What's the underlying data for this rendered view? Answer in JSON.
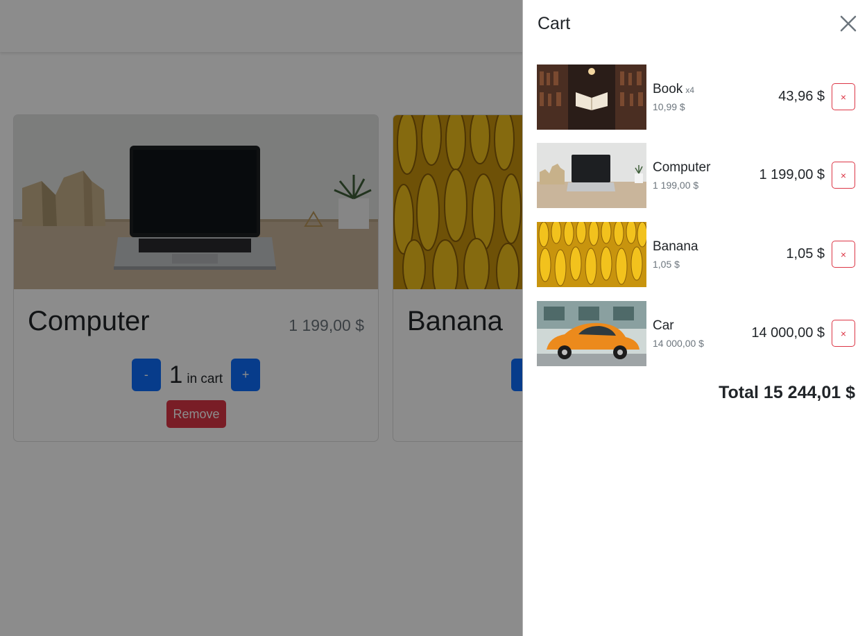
{
  "products": [
    {
      "title": "Computer",
      "price": "1 199,00 $",
      "qty": "1",
      "qty_label": "in cart",
      "minus": "-",
      "plus": "+",
      "remove": "Remove"
    },
    {
      "title": "Banana"
    }
  ],
  "cart": {
    "title": "Cart",
    "items": [
      {
        "name": "Book",
        "multiplier": "x4",
        "unit_price": "10,99 $",
        "total": "43,96 $",
        "remove": "×"
      },
      {
        "name": "Computer",
        "multiplier": "",
        "unit_price": "1 199,00 $",
        "total": "1 199,00 $",
        "remove": "×"
      },
      {
        "name": "Banana",
        "multiplier": "",
        "unit_price": "1,05 $",
        "total": "1,05 $",
        "remove": "×"
      },
      {
        "name": "Car",
        "multiplier": "",
        "unit_price": "14 000,00 $",
        "total": "14 000,00 $",
        "remove": "×"
      }
    ],
    "total": "Total 15 244,01 $"
  },
  "colors": {
    "primary": "#0d6efd",
    "danger": "#dc3545",
    "muted": "#6c757d"
  }
}
